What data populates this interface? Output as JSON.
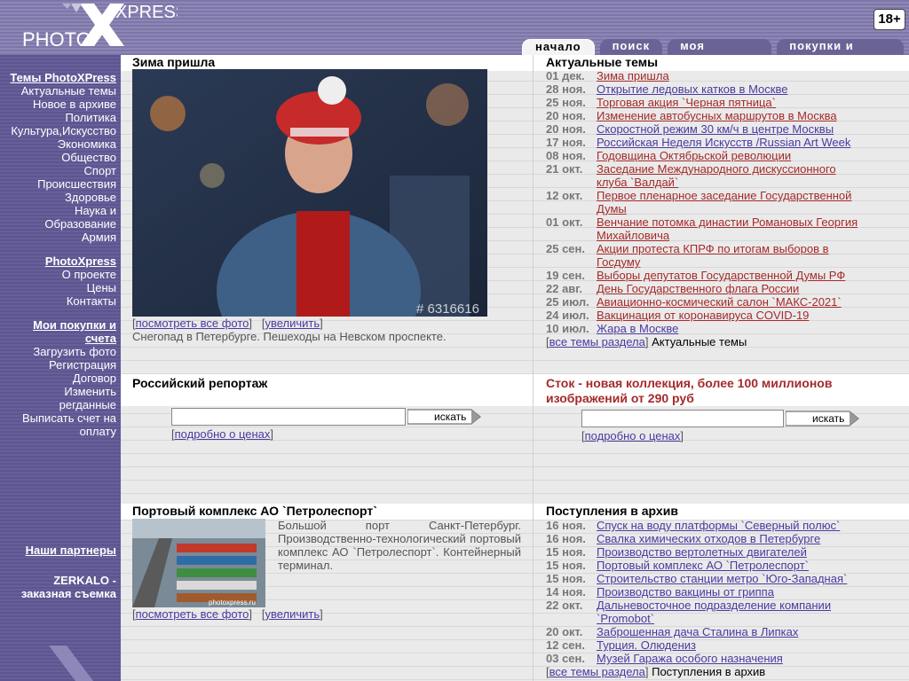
{
  "header": {
    "logo_text_photo": "PHOTO",
    "logo_text_xpress": "XPRESS",
    "age_badge": "18+",
    "tabs": [
      {
        "label": "начало",
        "active": true
      },
      {
        "label": "поиск"
      },
      {
        "label": "моя корзина"
      },
      {
        "label": "покупки и счета"
      }
    ]
  },
  "sidebar": {
    "groups": [
      {
        "items": [
          {
            "label": "Темы PhotoXPress",
            "style": "head"
          },
          {
            "label": "Актуальные темы"
          },
          {
            "label": "Новое в архиве"
          },
          {
            "label": "Политика"
          },
          {
            "label": "Культура,Искусство"
          },
          {
            "label": "Экономика"
          },
          {
            "label": "Общество"
          },
          {
            "label": "Спорт"
          },
          {
            "label": "Происшествия"
          },
          {
            "label": "Здоровье"
          },
          {
            "label": "Наука и"
          },
          {
            "label": "Образование"
          },
          {
            "label": "Армия"
          }
        ]
      },
      {
        "items": [
          {
            "label": "PhotoXpress",
            "style": "head"
          },
          {
            "label": "О проекте"
          },
          {
            "label": "Цены"
          },
          {
            "label": "Контакты"
          }
        ]
      },
      {
        "items": [
          {
            "label": "Мои покупки и",
            "style": "head"
          },
          {
            "label": "счета",
            "style": "head"
          },
          {
            "label": "Загрузить фото"
          },
          {
            "label": "Регистрация"
          },
          {
            "label": "Договор"
          },
          {
            "label": "Изменить"
          },
          {
            "label": "регданные"
          },
          {
            "label": "Выписать счет на"
          },
          {
            "label": "оплату"
          }
        ]
      }
    ],
    "partners": "Наши партнеры",
    "zerkalo_1": "ZERKALO -",
    "zerkalo_2": "заказная съемка"
  },
  "feature": {
    "title": "Зима пришла",
    "watermark": "# 6316616",
    "link_all": "посмотреть все фото",
    "link_zoom": "увеличить",
    "caption": "Снегопад в Петербурге. Пешеходы на Невском проспекте."
  },
  "actual": {
    "title": "Актуальные темы",
    "items": [
      {
        "date": "01 дек.",
        "lines": [
          "Зима пришла"
        ],
        "red": true
      },
      {
        "date": "28 ноя.",
        "lines": [
          "Открытие ледовых катков в Москве"
        ]
      },
      {
        "date": "25 ноя.",
        "lines": [
          "Торговая акция `Черная пятница`"
        ],
        "red": true
      },
      {
        "date": "20 ноя.",
        "lines": [
          "Изменение автобусных маршрутов в Москва"
        ],
        "red": true
      },
      {
        "date": "20 ноя.",
        "lines": [
          "Скоростной режим 30 км/ч в центре Москвы"
        ]
      },
      {
        "date": "17 ноя.",
        "lines": [
          "Российская Неделя Искусств /Russian Art Week"
        ]
      },
      {
        "date": "08 ноя.",
        "lines": [
          "Годовщина Октябрьской революции"
        ],
        "red": true
      },
      {
        "date": "21 окт.",
        "lines": [
          "Заседание Международного дискуссионного",
          "клуба `Валдай`"
        ],
        "red": true
      },
      {
        "date": "12 окт.",
        "lines": [
          "Первое пленарное заседание Государственной",
          "Думы"
        ],
        "red": true
      },
      {
        "date": "01 окт.",
        "lines": [
          "Венчание потомка династии Романовых Георгия",
          "Михайловича"
        ],
        "red": true
      },
      {
        "date": "25 сен.",
        "lines": [
          "Акции протеста КПРФ по итогам выборов в",
          "Госдуму"
        ],
        "red": true
      },
      {
        "date": "19 сен.",
        "lines": [
          "Выборы депутатов Государственной Думы РФ"
        ],
        "red": true
      },
      {
        "date": "22 авг.",
        "lines": [
          "День Государственного флага России"
        ],
        "red": true
      },
      {
        "date": "25 июл.",
        "lines": [
          "Авиационно-космический салон `МАКС-2021`"
        ],
        "red": true
      },
      {
        "date": "24 июл.",
        "lines": [
          "Вакцинация от коронавируса COVID-19"
        ],
        "red": true
      },
      {
        "date": "10 июл.",
        "lines": [
          "Жара в Москве"
        ]
      }
    ],
    "all_link": "все темы раздела",
    "all_suffix": "Актуальные темы"
  },
  "reportage": {
    "title": "Российский репортаж",
    "search_btn": "искать",
    "price_link": "подробно о ценах"
  },
  "stock": {
    "title": "Сток - новая коллекция, более 100 миллионов изображений от 290 руб",
    "search_btn": "искать",
    "price_link": "подробно о ценах"
  },
  "port": {
    "title": "Портовый комплекс АО `Петролеспорт`",
    "thumb_watermark": "photoxpress.ru",
    "desc": "Большой порт Санкт-Петербург. Производственно-технологический портовый комплекс АО `Петролеспорт`. Контейнерный терминал.",
    "link_all": "посмотреть все фото",
    "link_zoom": "увеличить"
  },
  "archive": {
    "title": "Поступления в архив",
    "items": [
      {
        "date": "16 ноя.",
        "text": "Спуск на воду платформы `Северный полюс`"
      },
      {
        "date": "16 ноя.",
        "text": "Свалка химических отходов в Петербурге"
      },
      {
        "date": "15 ноя.",
        "text": "Производство вертолетных двигателей"
      },
      {
        "date": "15 ноя.",
        "text": "Портовый комплекс АО `Петролеспорт`"
      },
      {
        "date": "15 ноя.",
        "text": "Строительство станции метро `Юго-Западная`"
      },
      {
        "date": "14 ноя.",
        "text": "Производство вакцины от гриппа"
      },
      {
        "date": "22 окт.",
        "text": "Дальневосточное подразделение компании",
        "text2": "`Promobot`"
      },
      {
        "date": "20 окт.",
        "text": "Заброшенная дача Сталина в Липках"
      },
      {
        "date": "12 сен.",
        "text": "Турция. Олюдениз"
      },
      {
        "date": "03 сен.",
        "text": "Музей Гаража особого назначения"
      }
    ],
    "all_link": "все темы раздела",
    "all_suffix": "Поступления в архив"
  }
}
